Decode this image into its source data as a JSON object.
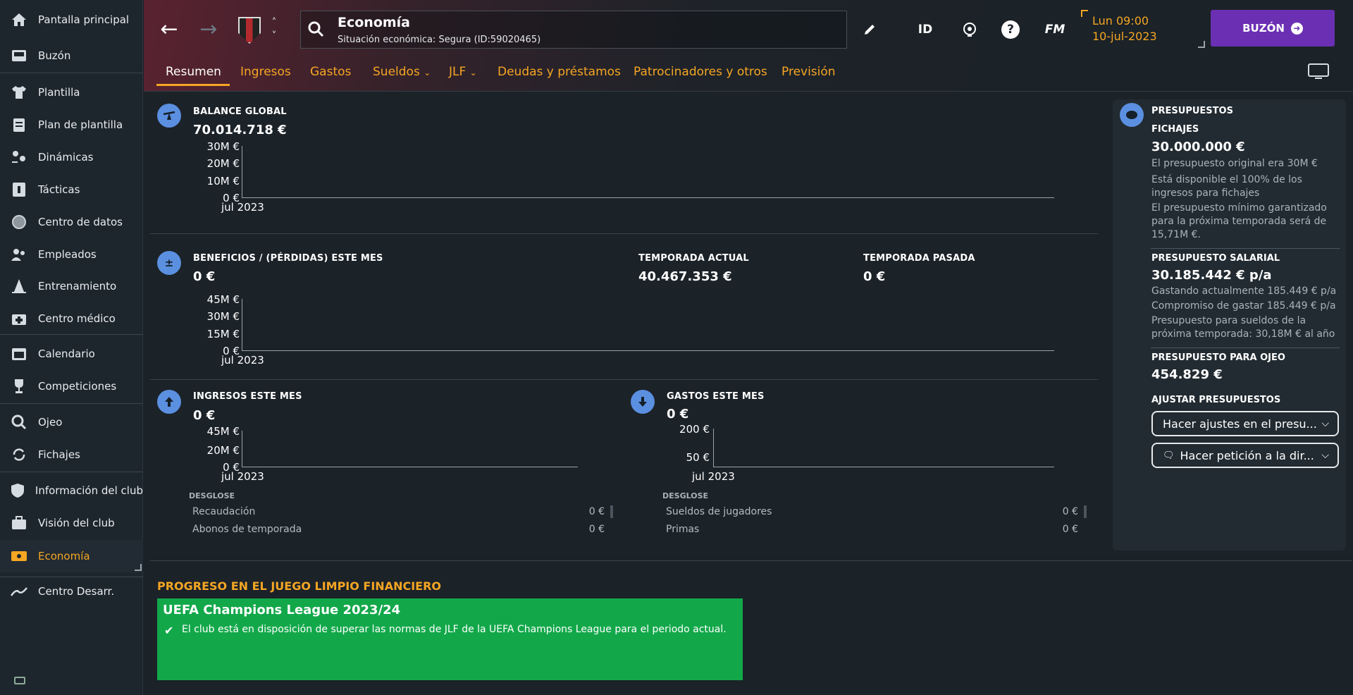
{
  "sidebar": {
    "items": [
      {
        "label": "Pantalla principal",
        "icon": "home-icon"
      },
      {
        "label": "Buzón",
        "icon": "inbox-icon"
      },
      {
        "label": "Plantilla",
        "icon": "shirt-icon"
      },
      {
        "label": "Plan de plantilla",
        "icon": "clipboard-icon"
      },
      {
        "label": "Dinámicas",
        "icon": "people-arrows-icon"
      },
      {
        "label": "Tácticas",
        "icon": "tactics-board-icon"
      },
      {
        "label": "Centro de datos",
        "icon": "data-circle-icon"
      },
      {
        "label": "Empleados",
        "icon": "staff-icon"
      },
      {
        "label": "Entrenamiento",
        "icon": "cone-icon"
      },
      {
        "label": "Centro médico",
        "icon": "medical-kit-icon"
      },
      {
        "label": "Calendario",
        "icon": "calendar-icon"
      },
      {
        "label": "Competiciones",
        "icon": "trophy-icon"
      },
      {
        "label": "Ojeo",
        "icon": "magnifier-icon"
      },
      {
        "label": "Fichajes",
        "icon": "transfer-arrows-icon"
      },
      {
        "label": "Información del club",
        "icon": "shield-icon"
      },
      {
        "label": "Visión del club",
        "icon": "briefcase-icon"
      },
      {
        "label": "Economía",
        "icon": "banknote-icon"
      },
      {
        "label": "Centro Desarr.",
        "icon": "growth-chart-icon"
      }
    ]
  },
  "header": {
    "search_title": "Economía",
    "search_subtitle": "Situación económica: Segura (ID:59020465)",
    "icons": [
      "pencil-icon",
      "id-icon",
      "globe-icon",
      "help-icon",
      "fm-icon"
    ],
    "id_label": "ID",
    "fm_label": "FM",
    "date_line1": "Lun 09:00",
    "date_line2": "10-jul-2023",
    "inbox_button": "BUZÓN",
    "tabs": [
      "Resumen",
      "Ingresos",
      "Gastos",
      "Sueldos",
      "JLF",
      "Deudas y préstamos",
      "Patrocinadores y otros",
      "Previsión"
    ],
    "active_tab": "Resumen",
    "colors": {
      "accent": "#f5a623",
      "inbox": "#6b2fb3"
    }
  },
  "balance": {
    "title": "BALANCE GLOBAL",
    "value": "70.014.718 €",
    "y_ticks": [
      "30M €",
      "20M €",
      "10M €",
      "0 €"
    ],
    "x_label": "jul 2023"
  },
  "profit": {
    "title": "BENEFICIOS / (PÉRDIDAS) ESTE MES",
    "value": "0 €",
    "current_title": "TEMPORADA ACTUAL",
    "current_value": "40.467.353 €",
    "past_title": "TEMPORADA PASADA",
    "past_value": "0 €",
    "y_ticks": [
      "45M €",
      "30M €",
      "15M €",
      "0 €"
    ],
    "x_label": "jul 2023"
  },
  "income": {
    "title": "INGRESOS ESTE MES",
    "value": "0 €",
    "y_ticks": [
      "45M €",
      "20M €",
      "0 €"
    ],
    "x_label": "jul 2023",
    "breakdown_title": "DESGLOSE",
    "rows": [
      {
        "label": "Recaudación",
        "value": "0 €"
      },
      {
        "label": "Abonos de temporada",
        "value": "0 €"
      }
    ]
  },
  "expenses": {
    "title": "GASTOS ESTE MES",
    "value": "0 €",
    "y_ticks": [
      "200 €",
      "50 €"
    ],
    "x_label": "jul 2023",
    "breakdown_title": "DESGLOSE",
    "rows": [
      {
        "label": "Sueldos de jugadores",
        "value": "0 €"
      },
      {
        "label": "Primas",
        "value": "0 €"
      }
    ]
  },
  "budgets": {
    "title": "PRESUPUESTOS",
    "transfers_title": "FICHAJES",
    "transfers_value": "30.000.000 €",
    "transfers_notes": [
      "El presupuesto original era 30M €",
      "Está disponible el 100% de los ingresos para fichajes",
      "El presupuesto mínimo garantizado para la próxima temporada será de 15,71M €."
    ],
    "wage_title": "PRESUPUESTO SALARIAL",
    "wage_value": "30.185.442 € p/a",
    "wage_notes": [
      "Gastando actualmente 185.449 € p/a",
      "Compromiso de gastar 185.449 € p/a",
      "Presupuesto para sueldos de la próxima temporada: 30,18M € al año"
    ],
    "scouting_title": "PRESUPUESTO PARA OJEO",
    "scouting_value": "454.829 €",
    "adjust_title": "AJUSTAR PRESUPUESTOS",
    "adjust_button": "Hacer ajustes en el presu...",
    "request_button": "Hacer petición a la dir..."
  },
  "ffp": {
    "title": "PROGRESO EN EL JUEGO LIMPIO FINANCIERO",
    "box_title": "UEFA Champions League 2023/24",
    "box_message": "El club está en disposición de superar las normas de JLF de la UEFA Champions League para el periodo actual.",
    "box_color": "#12a84a"
  }
}
